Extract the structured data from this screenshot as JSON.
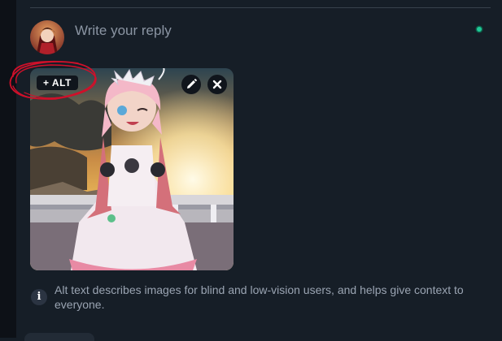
{
  "reply": {
    "placeholder": "Write your reply"
  },
  "media": {
    "alt_button_label": "+ ALT",
    "edit_icon": "pencil-icon",
    "remove_icon": "close-icon"
  },
  "info": {
    "icon": "i",
    "text": "Alt text describes images for blind and low-vision users, and helps give context to everyone."
  },
  "colors": {
    "background": "#161e27",
    "online": "#20c997",
    "annotation": "#d0102a"
  }
}
